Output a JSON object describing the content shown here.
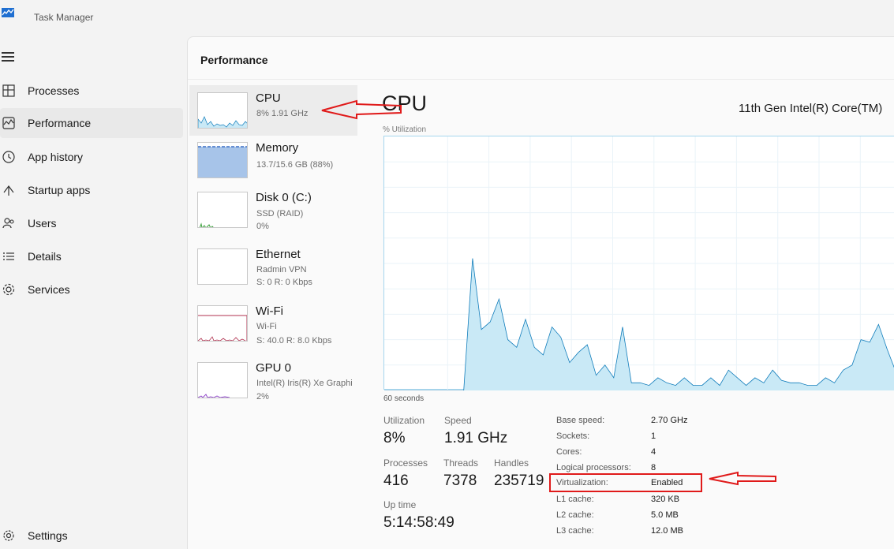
{
  "app": {
    "title": "Task Manager"
  },
  "nav": {
    "items": [
      {
        "label": "Processes",
        "icon": "processes-icon"
      },
      {
        "label": "Performance",
        "icon": "performance-icon",
        "active": true
      },
      {
        "label": "App history",
        "icon": "app-history-icon"
      },
      {
        "label": "Startup apps",
        "icon": "startup-apps-icon"
      },
      {
        "label": "Users",
        "icon": "users-icon"
      },
      {
        "label": "Details",
        "icon": "details-icon"
      },
      {
        "label": "Services",
        "icon": "services-icon"
      }
    ],
    "settings_label": "Settings"
  },
  "page": {
    "title": "Performance"
  },
  "devices": [
    {
      "name": "CPU",
      "sub1": "8% 1.91 GHz"
    },
    {
      "name": "Memory",
      "sub1": "13.7/15.6 GB (88%)"
    },
    {
      "name": "Disk 0 (C:)",
      "sub1": "SSD (RAID)",
      "sub2": "0%"
    },
    {
      "name": "Ethernet",
      "sub1": "Radmin VPN",
      "sub2": "S: 0 R: 0 Kbps"
    },
    {
      "name": "Wi-Fi",
      "sub1": "Wi-Fi",
      "sub2": "S: 40.0 R: 8.0 Kbps"
    },
    {
      "name": "GPU 0",
      "sub1": "Intel(R) Iris(R) Xe Graphi",
      "sub2": "2%"
    }
  ],
  "cpu": {
    "title": "CPU",
    "model": "11th Gen Intel(R) Core(TM)",
    "graph_label": "% Utilization",
    "graph_time": "60 seconds",
    "stats": {
      "utilization_label": "Utilization",
      "utilization": "8%",
      "speed_label": "Speed",
      "speed": "1.91 GHz",
      "processes_label": "Processes",
      "processes": "416",
      "threads_label": "Threads",
      "threads": "7378",
      "handles_label": "Handles",
      "handles": "235719",
      "uptime_label": "Up time",
      "uptime": "5:14:58:49"
    },
    "specs": [
      {
        "label": "Base speed:",
        "value": "2.70 GHz"
      },
      {
        "label": "Sockets:",
        "value": "1"
      },
      {
        "label": "Cores:",
        "value": "4"
      },
      {
        "label": "Logical processors:",
        "value": "8"
      },
      {
        "label": "Virtualization:",
        "value": "Enabled"
      },
      {
        "label": "L1 cache:",
        "value": "320 KB"
      },
      {
        "label": "L2 cache:",
        "value": "5.0 MB"
      },
      {
        "label": "L3 cache:",
        "value": "12.0 MB"
      }
    ],
    "utilization_history": [
      0,
      0,
      0,
      0,
      0,
      0,
      0,
      0,
      0,
      0,
      52,
      24,
      27,
      36,
      20,
      17,
      28,
      17,
      14,
      25,
      21,
      11,
      15,
      18,
      6,
      10,
      5,
      25,
      3,
      3,
      2,
      5,
      3,
      2,
      5,
      2,
      2,
      5,
      2,
      8,
      5,
      2,
      5,
      3,
      8,
      4,
      3,
      3,
      2,
      2,
      5,
      3,
      8,
      10,
      20,
      19,
      26,
      16,
      7,
      33
    ]
  },
  "colors": {
    "accent": "#117dbb",
    "graph_fill": "#c9e9f6",
    "graph_line": "#117dbb",
    "annotation": "#e01a1a"
  }
}
